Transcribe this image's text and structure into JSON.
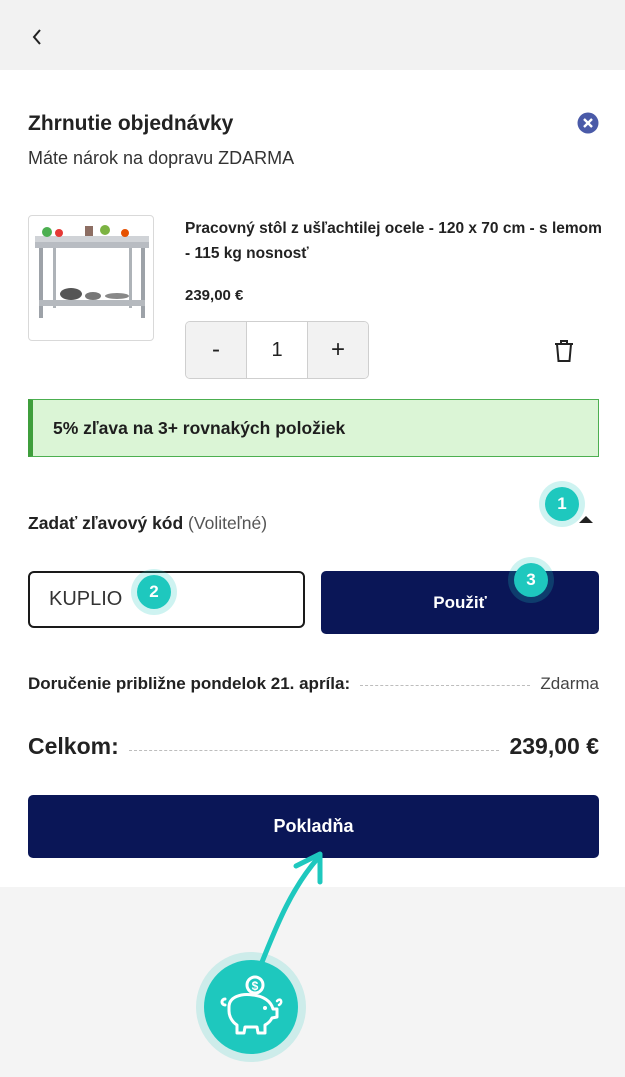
{
  "header": {
    "back_icon": "chevron-left-icon"
  },
  "summary": {
    "title": "Zhrnutie objednávky",
    "subtitle": "Máte nárok na dopravu ZDARMA",
    "close_icon": "close-circle-icon"
  },
  "product": {
    "name": "Pracovný stôl z ušľachtilej ocele - 120 x 70 cm - s lemom - 115 kg nosnosť",
    "price": "239,00 €",
    "quantity": "1",
    "minus_label": "-",
    "plus_label": "+",
    "trash_icon": "trash-icon"
  },
  "promo": {
    "text": "5% zľava na 3+ rovnakých položiek"
  },
  "discount": {
    "label_bold": "Zadať zľavový kód",
    "label_optional": " (Voliteľné)",
    "input_value": "KUPLIO",
    "apply_label": "Použiť"
  },
  "delivery": {
    "label": "Doručenie približne pondelok 21. apríla:",
    "value": "Zdarma"
  },
  "total": {
    "label": "Celkom:",
    "value": "239,00 €"
  },
  "checkout": {
    "label": "Pokladňa"
  },
  "annotations": {
    "badge1": "1",
    "badge2": "2",
    "badge3": "3",
    "accent_color": "#1ec8be"
  },
  "colors": {
    "primary": "#0a1657",
    "promo_bg": "#dbf5d6",
    "promo_border": "#3f9e3c"
  }
}
